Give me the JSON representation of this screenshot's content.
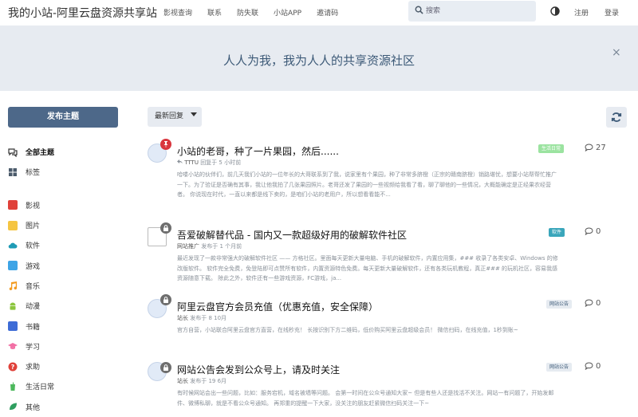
{
  "header": {
    "site_title": "我的小站-阿里云盘资源共享站",
    "nav": [
      "影视查询",
      "联系",
      "防失联",
      "小站APP",
      "邀请码"
    ],
    "search_placeholder": "搜索",
    "register": "注册",
    "login": "登录"
  },
  "hero": {
    "text": "人人为我，我为人人的共享资源社区",
    "close": "×"
  },
  "post_button": "发布主题",
  "sidebar": {
    "items": [
      {
        "label": "全部主题",
        "icon": "comments-icon",
        "color": "#333333"
      },
      {
        "label": "标签",
        "icon": "grid-icon",
        "color": "#4a5a6a"
      },
      {
        "label": "影视",
        "icon": "film-icon",
        "color": "#e0413a"
      },
      {
        "label": "图片",
        "icon": "image-icon",
        "color": "#f5c542"
      },
      {
        "label": "软件",
        "icon": "cloud-icon",
        "color": "#1f9bb5"
      },
      {
        "label": "游戏",
        "icon": "game-icon",
        "color": "#3ea4e6"
      },
      {
        "label": "音乐",
        "icon": "music-icon",
        "color": "#f39a1e"
      },
      {
        "label": "动漫",
        "icon": "android-icon",
        "color": "#8dc63f"
      },
      {
        "label": "书籍",
        "icon": "book-icon",
        "color": "#3d6bd6"
      },
      {
        "label": "学习",
        "icon": "graduation-icon",
        "color": "#f26fa4"
      },
      {
        "label": "求助",
        "icon": "question-icon",
        "color": "#e0413a"
      },
      {
        "label": "生活日常",
        "icon": "drink-icon",
        "color": "#4cb85c"
      },
      {
        "label": "其他",
        "icon": "leaf-icon",
        "color": "#2e9e5f"
      }
    ]
  },
  "toolbar": {
    "sort_label": "最新回复"
  },
  "posts": [
    {
      "title": "小站的老哥，种了一片果园，然后......",
      "meta_user": "TTTU",
      "meta_text": "回复于 5 小时前",
      "body": "哈喽小站的伙伴们，前几天我们小站的一位年长的大哥联系到了我，说家里有个果园，种了非常多脐橙（正宗的赣南脐橙）销路堪忧，想要小站帮帮忙推广一下。为了验证是否确有其事，我让他我拍了几张果园照片。老哥还发了果园的一些视频给我看了看，聊了聊他的一些情况，大概能确定是正经果农经营者。 你说现在时代，一直以来都是线下卖的，是咱们小站的老用户，所以想看看能不...",
      "tag": "生活日常",
      "tag_style": "green",
      "count": "27",
      "badge": "red"
    },
    {
      "title": "吾爱破解替代品 - 国内又一款超级好用的破解软件社区",
      "meta_user": "网站推广",
      "meta_text": "发布于 1 个月前",
      "body": "最近发现了一款非常强大的破解软件社区 —— 方格社区。里面每天更新大量电脑、手机的破解软件，内置应用集，### 收录了各类安卓、Windows 的修改版软件。 软件完全免费，免登陆即可点赞所有软件，内置资源特色免费。每天更新大量破解软件，还有各类玩机教程，真正### 的玩机社区，容易我感资源随意下载。 除此之外，软件还有一些游戏资源，FC游戏，ja...",
      "tag": "软件",
      "tag_style": "teal",
      "count": "0",
      "badge": "gray"
    },
    {
      "title": "阿里云盘官方会员充值（优惠充值，安全保障）",
      "meta_user": "站长",
      "meta_text": "发布于 8 10月",
      "body": "官方自营，小站联合阿里云盘官方直营，在线秒充！ 长按识别下方二维码，低价购买阿里云盘超级会员！ 微信扫码，在线充值，1秒到账~",
      "tag": "网站公告",
      "tag_style": "gray",
      "count": "0",
      "badge": "gray"
    },
    {
      "title": "网站公告会发到公众号上，请及时关注",
      "meta_user": "站长",
      "meta_text": "发布于 19 6月",
      "body": "有时候网站会出一些问题，比如：服务宕机，域名被墙等问题。 会第一时间在公众号通知大家~ 但是有些人还是找活不关注。网站一有问题了，开始发邮件、微博私聊，就是不看公众号通知。 再郑重的提醒一下大家，没关注的朋友赶紧微信扫码关注一下~",
      "tag": "网站公告",
      "tag_style": "gray",
      "count": "0",
      "badge": "gray"
    }
  ],
  "colors": {
    "primary": "#4d6889",
    "hero_bg": "#e7ebf1",
    "hero_text": "#3d5a78"
  }
}
